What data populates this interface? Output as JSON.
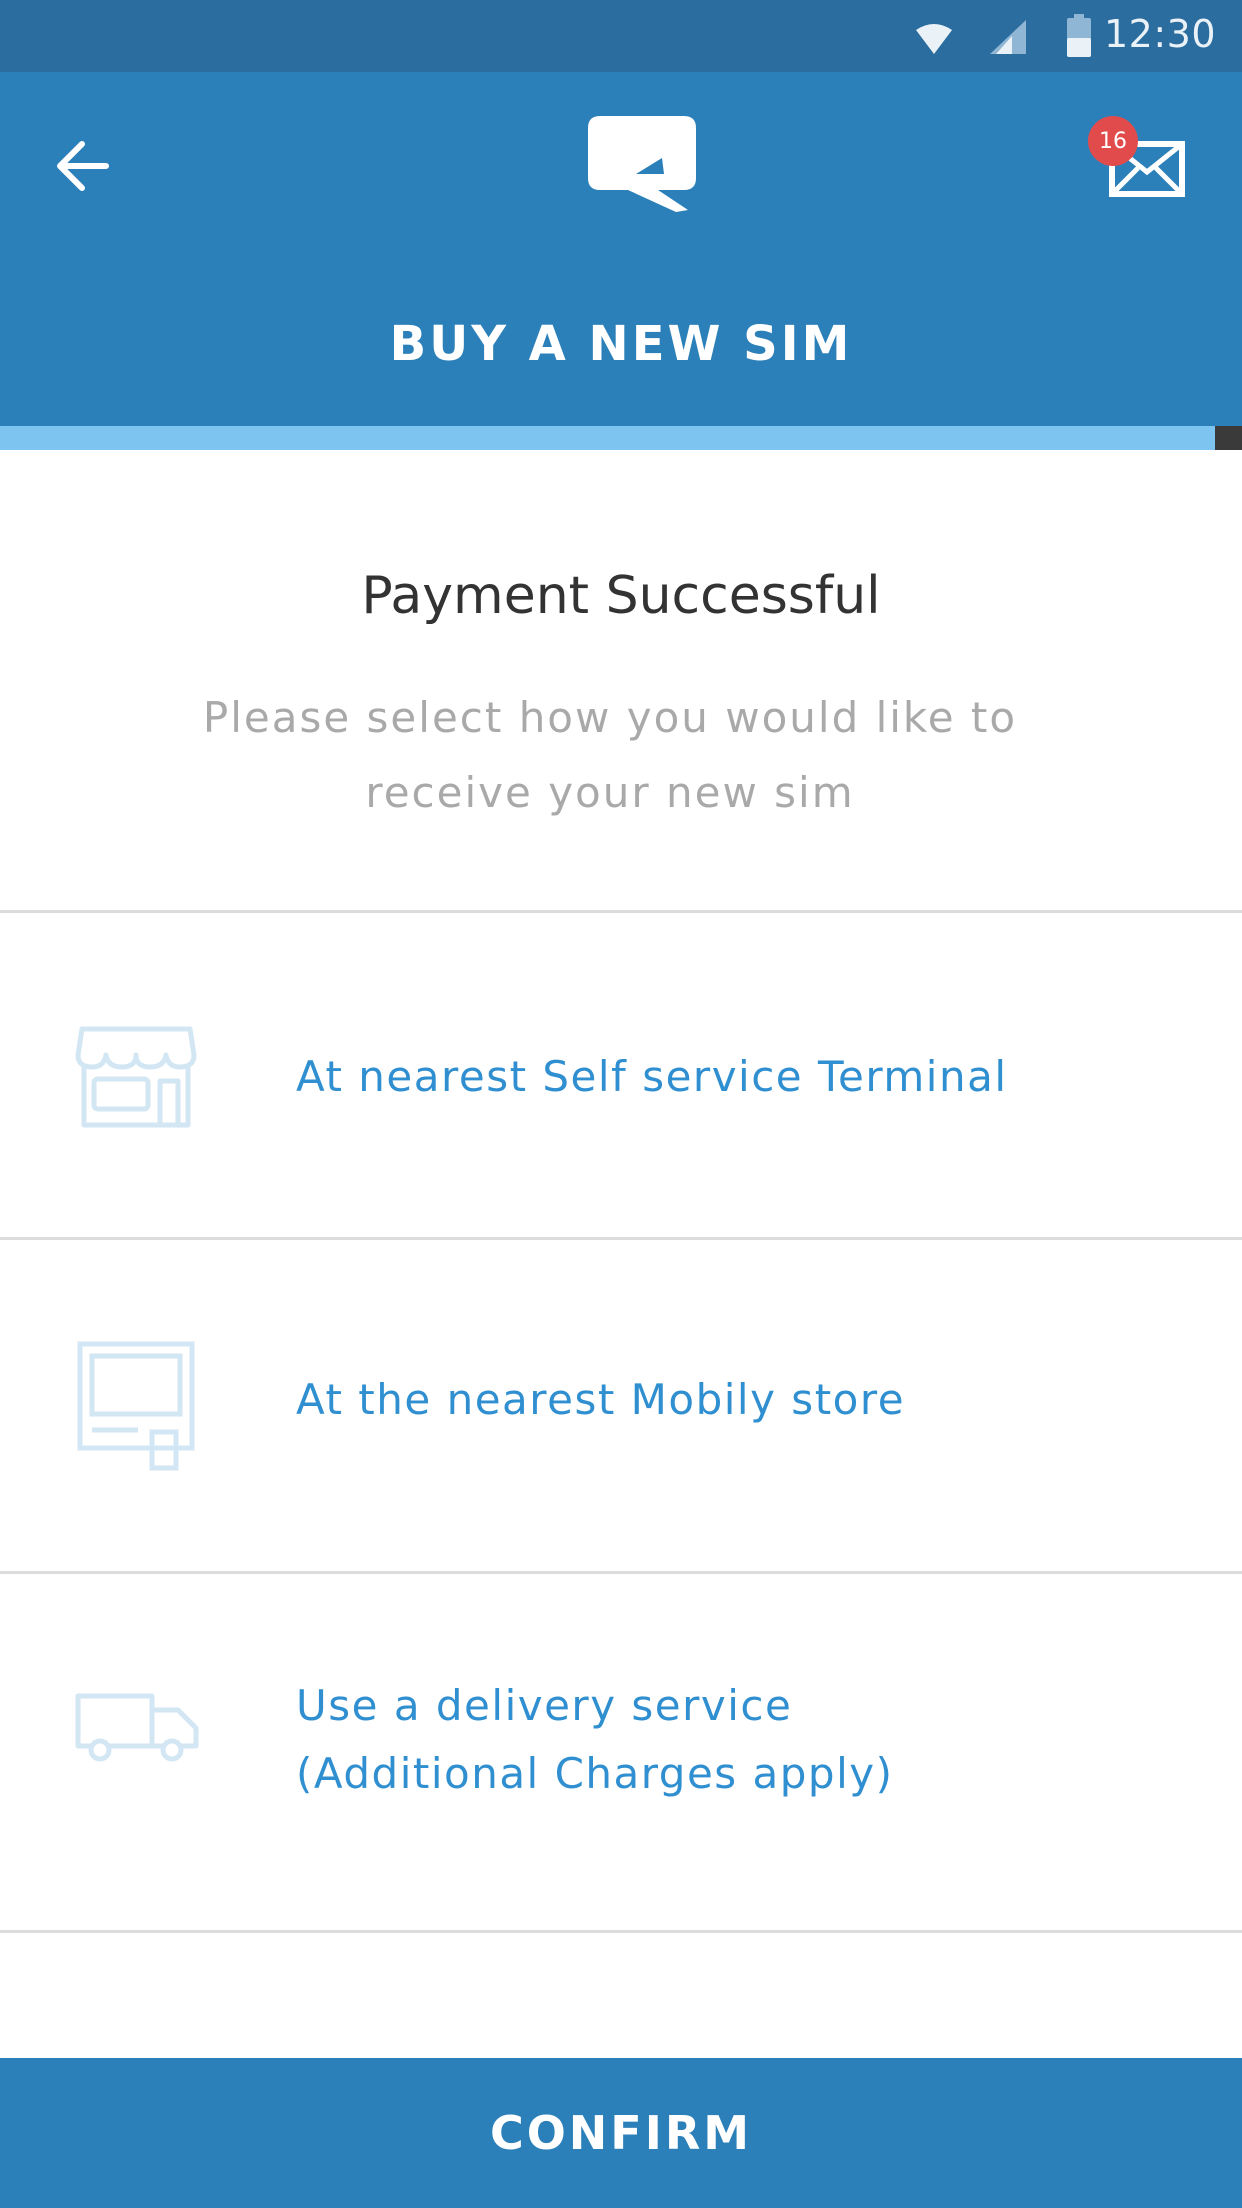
{
  "status_bar": {
    "time": "12:30"
  },
  "header": {
    "title": "BUY A NEW SIM",
    "unread_count": "16",
    "progress": 0.978,
    "icons": {
      "back": "arrow-left-icon",
      "logo": "mobily-logo-icon",
      "mail": "envelope-icon"
    }
  },
  "content": {
    "heading": "Payment Successful",
    "subheading": "Please select how you would like to receive your new sim"
  },
  "options": [
    {
      "label": "At nearest Self service Terminal",
      "icon": "storefront-icon"
    },
    {
      "label": "At the nearest Mobily store",
      "icon": "kiosk-terminal-icon"
    },
    {
      "label_line1": "Use a delivery service",
      "label_line2": "(Additional Charges apply)",
      "icon": "delivery-truck-icon"
    }
  ],
  "confirm_label": "CONFIRM",
  "colors": {
    "status_bar": "#2b6d9f",
    "header": "#2c80b9",
    "progress": "#7ec4f0",
    "accent_text": "#2f8fd0",
    "badge": "#e24b4b"
  }
}
